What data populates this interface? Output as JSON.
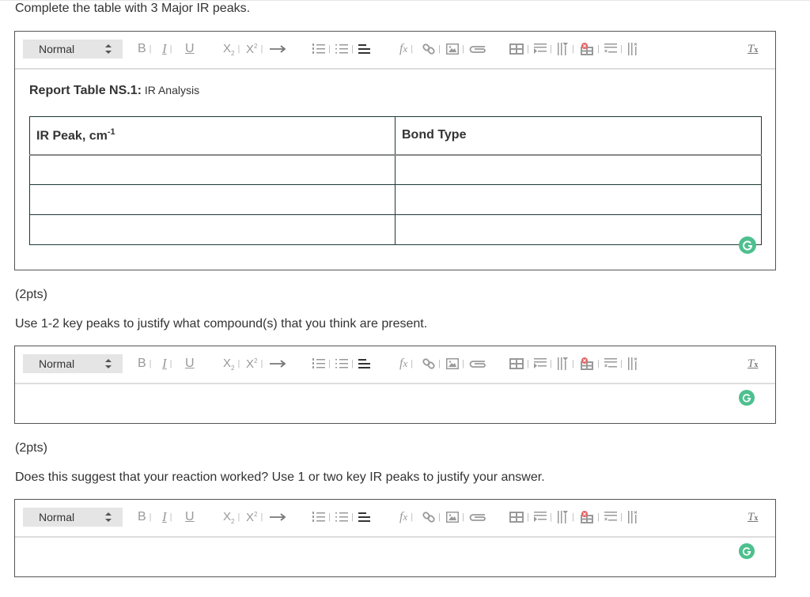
{
  "questions": [
    {
      "prompt": "Complete the table with 3 Major IR peaks.",
      "editor": {
        "style_select": "Normal",
        "caption_bold": "Report Table NS.1:",
        "caption_rest": " IR Analysis",
        "table": {
          "headers": [
            "IR Peak, cm",
            "Bond Type"
          ],
          "header_superscript": "-1",
          "rows": [
            [
              "",
              ""
            ],
            [
              "",
              ""
            ],
            [
              "",
              ""
            ]
          ]
        }
      }
    },
    {
      "points": "(2pts)",
      "prompt": "Use 1-2 key peaks to justify what compound(s) that you think are present.",
      "editor": {
        "style_select": "Normal",
        "content": ""
      }
    },
    {
      "points": "(2pts)",
      "prompt": "Does this suggest that your reaction worked? Use 1 or two key IR peaks to justify your answer.",
      "editor": {
        "style_select": "Normal",
        "content": ""
      }
    }
  ],
  "toolbar_buttons": [
    {
      "icon": "bold-icon",
      "label": "B"
    },
    {
      "icon": "italic-icon",
      "label": "I"
    },
    {
      "icon": "underline-icon",
      "label": "U"
    },
    {
      "icon": "subscript-icon",
      "label": "X₂"
    },
    {
      "icon": "superscript-icon",
      "label": "X²"
    },
    {
      "icon": "arrow-icon",
      "label": "→"
    },
    {
      "icon": "ordered-list-icon"
    },
    {
      "icon": "unordered-list-icon"
    },
    {
      "icon": "align-left-icon"
    },
    {
      "icon": "formula-icon",
      "label": "fx"
    },
    {
      "icon": "link-icon"
    },
    {
      "icon": "image-icon"
    },
    {
      "icon": "attachment-icon"
    },
    {
      "icon": "insert-table-icon"
    },
    {
      "icon": "insert-row-icon"
    },
    {
      "icon": "insert-column-icon"
    },
    {
      "icon": "delete-table-icon"
    },
    {
      "icon": "delete-row-icon"
    },
    {
      "icon": "delete-column-icon"
    },
    {
      "icon": "clear-format-icon",
      "label": "Tx"
    }
  ],
  "colors": {
    "grammarly": "#4dc08e",
    "delete_red": "#e06666"
  }
}
